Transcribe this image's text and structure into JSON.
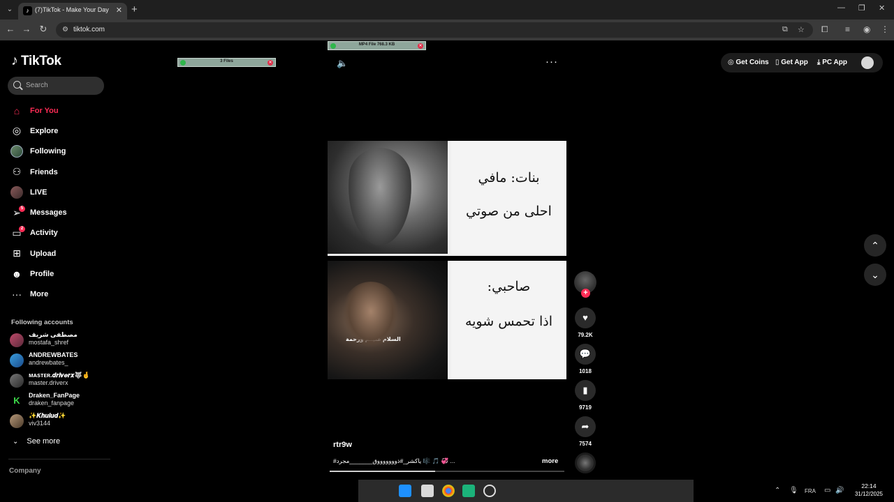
{
  "browser": {
    "tab_title": "(7)TikTok - Make Your Day",
    "url": "tiktok.com"
  },
  "sidebar": {
    "logo": "TikTok",
    "search_placeholder": "Search",
    "nav": [
      {
        "label": "For You",
        "icon": "home-icon",
        "active": true
      },
      {
        "label": "Explore",
        "icon": "compass-icon"
      },
      {
        "label": "Following",
        "icon": "avatar-icon"
      },
      {
        "label": "Friends",
        "icon": "friends-icon"
      },
      {
        "label": "LIVE",
        "icon": "live-icon"
      },
      {
        "label": "Messages",
        "icon": "send-icon",
        "badge": "5"
      },
      {
        "label": "Activity",
        "icon": "inbox-icon",
        "badge": "2"
      },
      {
        "label": "Upload",
        "icon": "plus-square-icon"
      },
      {
        "label": "Profile",
        "icon": "user-icon"
      },
      {
        "label": "More",
        "icon": "ellipsis-icon"
      }
    ],
    "following_title": "Following accounts",
    "accounts": [
      {
        "name": "مصطفى شريف",
        "handle": "mostafa_shref"
      },
      {
        "name": "ANDREWBATES",
        "handle": "andrewbates_"
      },
      {
        "name": "ᴍᴀsᴛᴇʀ.𝒅𝒓𝒊𝒗𝒆𝒓𝒙🐺🤞",
        "handle": "master.driverx"
      },
      {
        "name": "Draken_FanPage",
        "handle": "draken_fanpage"
      },
      {
        "name": "✨𝑲𝒉𝒖𝒍𝒖𝒅✨",
        "handle": "viv3144"
      }
    ],
    "see_more": "See more",
    "company": "Company"
  },
  "downloads": {
    "left": "3 Files",
    "right": "MP4 File 768.3 KB"
  },
  "header": {
    "get_coins": "Get Coins",
    "get_app": "Get App",
    "pc_app": "PC App"
  },
  "video": {
    "text_top_1": "بنات: مافي",
    "text_top_2": "احلى من صوتي",
    "text_bot_1": "صاحبي:",
    "text_bot_2": "اذا تحمس شويه",
    "man_caption": "السلام عليكم ورحمة",
    "author": "rtr9w",
    "description": "#ياكشر_#ذوووووووق_______مجرد 🎼 🎵 💞 ...",
    "more": "more",
    "progress": 0.45
  },
  "actions": {
    "likes": "79.2K",
    "comments": "1018",
    "saves": "9719",
    "shares": "7574"
  },
  "taskbar": {
    "lang": "FRA",
    "time": "22:14",
    "date": "31/12/2025"
  }
}
